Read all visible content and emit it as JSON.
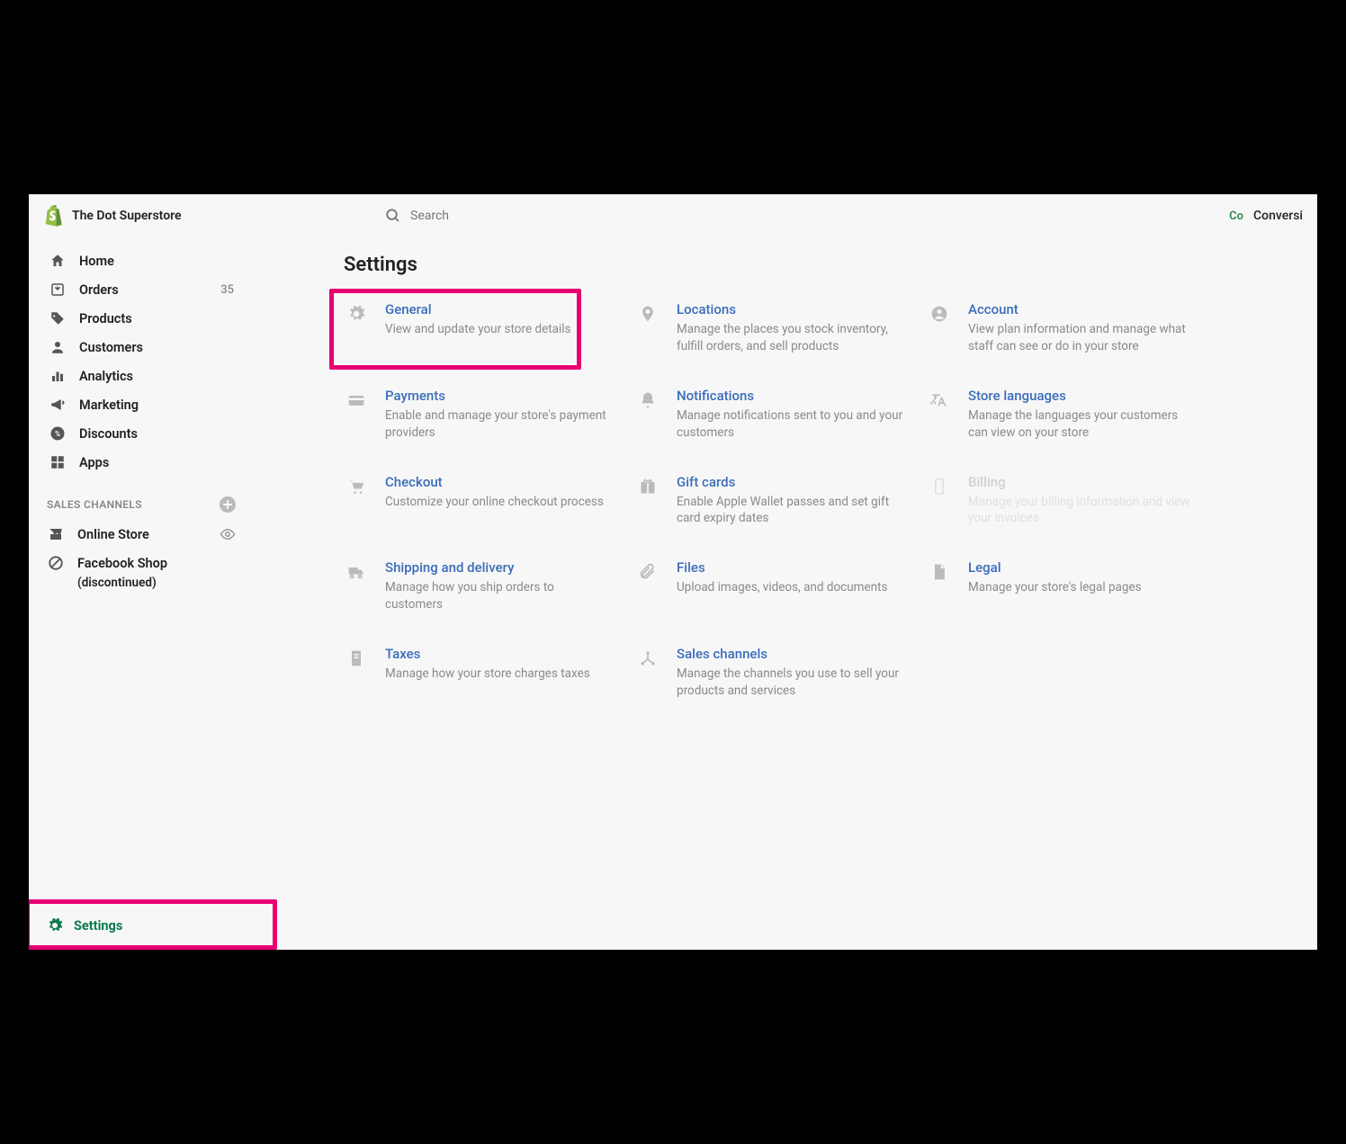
{
  "header": {
    "store_name": "The Dot Superstore",
    "search_placeholder": "Search",
    "right_label": "Conversi"
  },
  "sidebar": {
    "items": [
      {
        "label": "Home",
        "icon": "home",
        "badge": ""
      },
      {
        "label": "Orders",
        "icon": "orders",
        "badge": "35"
      },
      {
        "label": "Products",
        "icon": "tag",
        "badge": ""
      },
      {
        "label": "Customers",
        "icon": "person",
        "badge": ""
      },
      {
        "label": "Analytics",
        "icon": "bars",
        "badge": ""
      },
      {
        "label": "Marketing",
        "icon": "megaphone",
        "badge": ""
      },
      {
        "label": "Discounts",
        "icon": "percent",
        "badge": ""
      },
      {
        "label": "Apps",
        "icon": "grid",
        "badge": ""
      }
    ],
    "channels_title": "SALES CHANNELS",
    "channels": [
      {
        "label": "Online Store",
        "icon": "store",
        "eye": true,
        "sub": ""
      },
      {
        "label": "Facebook Shop",
        "icon": "cancel",
        "eye": false,
        "sub": "(discontinued)"
      }
    ],
    "settings_label": "Settings"
  },
  "main": {
    "title": "Settings",
    "cards": [
      {
        "icon": "gear",
        "title": "General",
        "desc": "View and update your store details"
      },
      {
        "icon": "pin",
        "title": "Locations",
        "desc": "Manage the places you stock inventory, fulfill orders, and sell products"
      },
      {
        "icon": "avatar",
        "title": "Account",
        "desc": "View plan information and manage what staff can see or do in your store"
      },
      {
        "icon": "card",
        "title": "Payments",
        "desc": "Enable and manage your store's payment providers"
      },
      {
        "icon": "bell",
        "title": "Notifications",
        "desc": "Manage notifications sent to you and your customers"
      },
      {
        "icon": "lang",
        "title": "Store languages",
        "desc": "Manage the languages your customers can view on your store"
      },
      {
        "icon": "cart",
        "title": "Checkout",
        "desc": "Customize your online checkout process"
      },
      {
        "icon": "gift",
        "title": "Gift cards",
        "desc": "Enable Apple Wallet passes and set gift card expiry dates"
      },
      {
        "icon": "phone",
        "title": "Billing",
        "desc": "Manage your billing information and view your invoices",
        "muted": true
      },
      {
        "icon": "truck",
        "title": "Shipping and delivery",
        "desc": "Manage how you ship orders to customers"
      },
      {
        "icon": "clip",
        "title": "Files",
        "desc": "Upload images, videos, and documents"
      },
      {
        "icon": "doc",
        "title": "Legal",
        "desc": "Manage your store's legal pages"
      },
      {
        "icon": "receipt",
        "title": "Taxes",
        "desc": "Manage how your store charges taxes"
      },
      {
        "icon": "channels",
        "title": "Sales channels",
        "desc": "Manage the channels you use to sell your products and services"
      }
    ]
  }
}
